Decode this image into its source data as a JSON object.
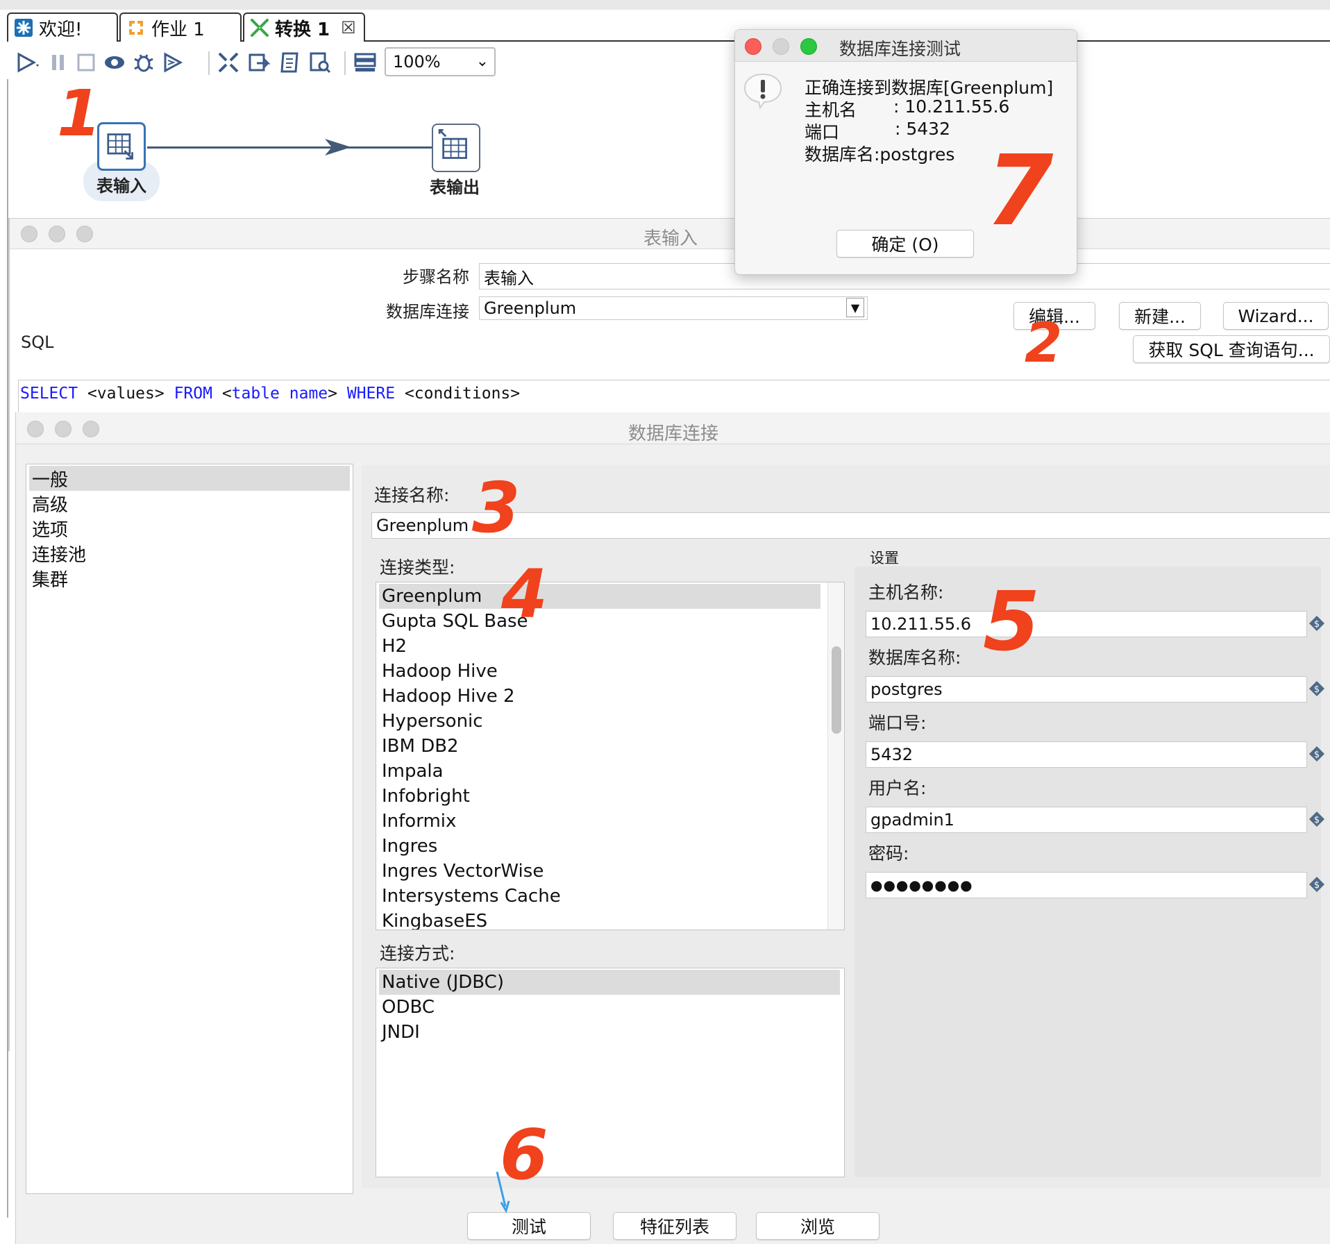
{
  "tabs": [
    {
      "label": "欢迎!",
      "icon": "kettle-welcome-icon"
    },
    {
      "label": "作业 1",
      "icon": "job-icon"
    },
    {
      "label": "转换 1",
      "icon": "transformation-icon",
      "active": true
    }
  ],
  "toolbar": {
    "zoom_value": "100%"
  },
  "canvas": {
    "steps": [
      {
        "label": "表输入",
        "icon": "table-input-icon"
      },
      {
        "label": "表输出",
        "icon": "table-output-icon"
      }
    ],
    "annotations": [
      "1",
      "2",
      "3",
      "4",
      "5",
      "6",
      "7"
    ]
  },
  "table_input_dialog": {
    "title": "表输入",
    "step_name_label": "步骤名称",
    "step_name_value": "表输入",
    "db_conn_label": "数据库连接",
    "db_conn_value": "Greenplum",
    "edit_button": "编辑...",
    "new_button": "新建...",
    "wizard_button": "Wizard...",
    "get_sql_button": "获取 SQL 查询语句...",
    "sql_label": "SQL",
    "sql_tokens": [
      {
        "text": "SELECT",
        "kind": "keyword"
      },
      {
        "text": " <values> ",
        "kind": "plain"
      },
      {
        "text": "FROM",
        "kind": "keyword"
      },
      {
        "text": " <",
        "kind": "plain"
      },
      {
        "text": "table name",
        "kind": "keyword"
      },
      {
        "text": "> ",
        "kind": "plain"
      },
      {
        "text": "WHERE",
        "kind": "keyword"
      },
      {
        "text": " <conditions>",
        "kind": "plain"
      }
    ]
  },
  "db_conn_dialog": {
    "title": "数据库连接",
    "nav": [
      "一般",
      "高级",
      "选项",
      "连接池",
      "集群"
    ],
    "conn_name_label": "连接名称:",
    "conn_name_value": "Greenplum",
    "conn_type_label": "连接类型:",
    "conn_types": [
      "Greenplum",
      "Gupta SQL Base",
      "H2",
      "Hadoop Hive",
      "Hadoop Hive 2",
      "Hypersonic",
      "IBM DB2",
      "Impala",
      "Infobright",
      "Informix",
      "Ingres",
      "Ingres VectorWise",
      "Intersystems Cache",
      "KingbaseES"
    ],
    "access_label": "连接方式:",
    "access_types": [
      "Native (JDBC)",
      "ODBC",
      "JNDI"
    ],
    "settings_label": "设置",
    "host_label": "主机名称:",
    "host_value": "10.211.55.6",
    "dbname_label": "数据库名称:",
    "dbname_value": "postgres",
    "port_label": "端口号:",
    "port_value": "5432",
    "user_label": "用户名:",
    "user_value": "gpadmin1",
    "password_label": "密码:",
    "password_value": "●●●●●●●●",
    "test_button": "测试",
    "features_button": "特征列表",
    "explore_button": "浏览"
  },
  "test_dialog": {
    "title": "数据库连接测试",
    "line1": "正确连接到数据库[Greenplum]",
    "line2_label": "主机名",
    "line2_value": ": 10.211.55.6",
    "line3_label": "端口",
    "line3_value": ": 5432",
    "line4": "数据库名:postgres",
    "ok_button": "确定 (O)"
  },
  "colors": {
    "sql_keyword": "#1a1aff",
    "annotation": "#f0421c",
    "step_border": "#3872b5",
    "hop": "#435a78",
    "mac_close": "#fc5f57",
    "mac_min": "#d4d4d4",
    "mac_max": "#2ac940"
  }
}
